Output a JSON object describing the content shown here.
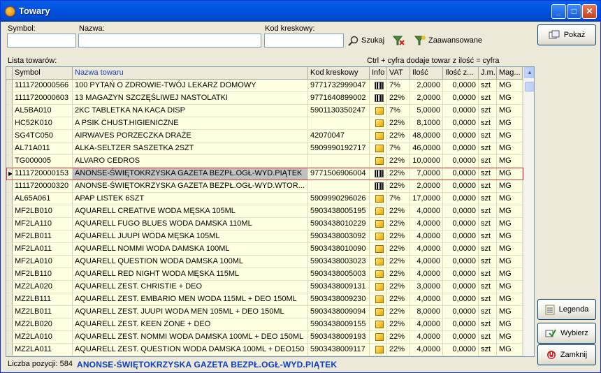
{
  "window": {
    "title": "Towary",
    "min": "_",
    "max": "□",
    "close": "✕"
  },
  "filters": {
    "symbol_label": "Symbol:",
    "name_label": "Nazwa:",
    "barcode_label": "Kod kreskowy:",
    "symbol_value": "",
    "name_value": "",
    "barcode_value": "",
    "search_label": "Szukaj",
    "advanced_label": "Zaawansowane"
  },
  "list_label": "Lista towarów:",
  "hint": "Ctrl + cyfra dodaje towar z ilość = cyfra",
  "buttons": {
    "show": "Pokaż",
    "legend": "Legenda",
    "select": "Wybierz",
    "close": "Zamknij"
  },
  "columns": [
    "Symbol",
    "Nazwa towaru",
    "Kod kreskowy",
    "Info",
    "VAT",
    "Ilość",
    "Ilość z...",
    "J.m.",
    "Mag..."
  ],
  "rows": [
    {
      "symbol": "1111720000566",
      "name": "100 PYTAŃ O ZDROWIE-TWÓJ LEKARZ DOMOWY",
      "code": "9771732999047",
      "info": "barcode",
      "vat": "7%",
      "qty": "2,0000",
      "qtyz": "0,0000",
      "jm": "szt",
      "mag": "MG"
    },
    {
      "symbol": "1111720000603",
      "name": "13 MAGAZYN SZCZĘŚLIWEJ NASTOLATKI",
      "code": "9771640899002",
      "info": "barcode",
      "vat": "22%",
      "qty": "2,0000",
      "qtyz": "0,0000",
      "jm": "szt",
      "mag": "MG"
    },
    {
      "symbol": "AL5BA010",
      "name": "2KC TABLETKA NA KACA DISP",
      "code": "5901130350247",
      "info": "box",
      "vat": "7%",
      "qty": "5,0000",
      "qtyz": "0,0000",
      "jm": "szt",
      "mag": "MG"
    },
    {
      "symbol": "HC52K010",
      "name": "A PSIK CHUST.HIGIENICZNE",
      "code": "",
      "info": "box",
      "vat": "22%",
      "qty": "8,1000",
      "qtyz": "0,0000",
      "jm": "szt",
      "mag": "MG"
    },
    {
      "symbol": "SG4TC050",
      "name": "AIRWAVES PORZECZKA DRAŻE",
      "code": "42070047",
      "info": "box",
      "vat": "22%",
      "qty": "48,0000",
      "qtyz": "0,0000",
      "jm": "szt",
      "mag": "MG"
    },
    {
      "symbol": "AL71A011",
      "name": "ALKA-SELTZER SASZETKA 2SZT",
      "code": "5909990192717",
      "info": "box",
      "vat": "7%",
      "qty": "46,0000",
      "qtyz": "0,0000",
      "jm": "szt",
      "mag": "MG"
    },
    {
      "symbol": "TG000005",
      "name": "ALVARO CEDROS",
      "code": "",
      "info": "box",
      "vat": "22%",
      "qty": "10,0000",
      "qtyz": "0,0000",
      "jm": "szt",
      "mag": "MG"
    },
    {
      "symbol": "1111720000153",
      "name": "ANONSE-ŚWIĘTOKRZYSKA GAZETA BEZPŁ.OGŁ-WYD.PIĄTEK",
      "code": "9771506906004",
      "info": "barcode",
      "vat": "22%",
      "qty": "7,0000",
      "qtyz": "0,0000",
      "jm": "szt",
      "mag": "MG",
      "selected": true
    },
    {
      "symbol": "1111720000320",
      "name": "ANONSE-ŚWIĘTOKRZYSKA GAZETA BEZPŁ.OGŁ-WYD.WTOR...",
      "code": "",
      "info": "barcode",
      "vat": "22%",
      "qty": "2,0000",
      "qtyz": "0,0000",
      "jm": "szt",
      "mag": "MG"
    },
    {
      "symbol": "AL65A061",
      "name": "APAP LISTEK 6SZT",
      "code": "5909990296026",
      "info": "box",
      "vat": "7%",
      "qty": "17,0000",
      "qtyz": "0,0000",
      "jm": "szt",
      "mag": "MG"
    },
    {
      "symbol": "MF2LB010",
      "name": "AQUARELL CREATIVE WODA MĘSKA 105ML",
      "code": "5903438005195",
      "info": "box",
      "vat": "22%",
      "qty": "4,0000",
      "qtyz": "0,0000",
      "jm": "szt",
      "mag": "MG"
    },
    {
      "symbol": "MF2LA110",
      "name": "AQUARELL FUGO BLUES WODA DAMSKA 110ML",
      "code": "5903438010229",
      "info": "box",
      "vat": "22%",
      "qty": "4,0000",
      "qtyz": "0,0000",
      "jm": "szt",
      "mag": "MG"
    },
    {
      "symbol": "MF2LB011",
      "name": "AQUARELL JUUPI WODA MĘSKA 105ML",
      "code": "5903438003092",
      "info": "box",
      "vat": "22%",
      "qty": "4,0000",
      "qtyz": "0,0000",
      "jm": "szt",
      "mag": "MG"
    },
    {
      "symbol": "MF2LA011",
      "name": "AQUARELL NOMMI WODA DAMSKA 100ML",
      "code": "5903438010090",
      "info": "box",
      "vat": "22%",
      "qty": "4,0000",
      "qtyz": "0,0000",
      "jm": "szt",
      "mag": "MG"
    },
    {
      "symbol": "MF2LA010",
      "name": "AQUARELL QUESTION WODA DAMSKA 100ML",
      "code": "5903438003023",
      "info": "box",
      "vat": "22%",
      "qty": "4,0000",
      "qtyz": "0,0000",
      "jm": "szt",
      "mag": "MG"
    },
    {
      "symbol": "MF2LB110",
      "name": "AQUARELL RED NIGHT WODA MĘSKA 115ML",
      "code": "5903438005003",
      "info": "box",
      "vat": "22%",
      "qty": "4,0000",
      "qtyz": "0,0000",
      "jm": "szt",
      "mag": "MG"
    },
    {
      "symbol": "MZ2LA020",
      "name": "AQUARELL ZEST. CHRISTIE + DEO",
      "code": "5903438009131",
      "info": "box",
      "vat": "22%",
      "qty": "3,0000",
      "qtyz": "0,0000",
      "jm": "szt",
      "mag": "MG"
    },
    {
      "symbol": "MZ2LB111",
      "name": "AQUARELL ZEST. EMBARIO MEN WODA 115ML + DEO 150ML",
      "code": "5903438009230",
      "info": "box",
      "vat": "22%",
      "qty": "4,0000",
      "qtyz": "0,0000",
      "jm": "szt",
      "mag": "MG"
    },
    {
      "symbol": "MZ2LB011",
      "name": "AQUARELL ZEST. JUUPI WODA MEN 105ML + DEO 150ML",
      "code": "5903438009094",
      "info": "box",
      "vat": "22%",
      "qty": "8,0000",
      "qtyz": "0,0000",
      "jm": "szt",
      "mag": "MG"
    },
    {
      "symbol": "MZ2LB020",
      "name": "AQUARELL ZEST. KEEN ZONE + DEO",
      "code": "5903438009155",
      "info": "box",
      "vat": "22%",
      "qty": "4,0000",
      "qtyz": "0,0000",
      "jm": "szt",
      "mag": "MG"
    },
    {
      "symbol": "MZ2LA010",
      "name": "AQUARELL ZEST. NOMMI WODA DAMSKA 100ML + DEO 150ML",
      "code": "5903438009193",
      "info": "box",
      "vat": "22%",
      "qty": "4,0000",
      "qtyz": "0,0000",
      "jm": "szt",
      "mag": "MG"
    },
    {
      "symbol": "MZ2LA011",
      "name": "AQUARELL ZEST. QUESTION WODA DAMSKA 100ML + DEO150",
      "code": "5903438009117",
      "info": "box",
      "vat": "22%",
      "qty": "4,0000",
      "qtyz": "0,0000",
      "jm": "szt",
      "mag": "MG"
    }
  ],
  "status": {
    "count_label": "Liczba pozycji: 584",
    "current": "ANONSE-ŚWIĘTOKRZYSKA GAZETA BEZPŁ.OGŁ-WYD.PIĄTEK"
  }
}
